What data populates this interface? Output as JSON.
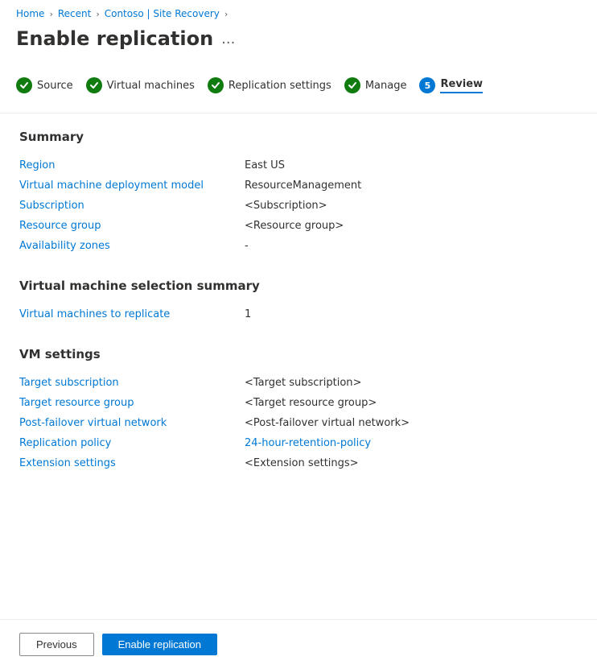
{
  "breadcrumb": {
    "items": [
      {
        "label": "Home",
        "link": true
      },
      {
        "label": "Recent",
        "link": true
      },
      {
        "label": "Contoso | Site Recovery",
        "link": true
      }
    ]
  },
  "page": {
    "title": "Enable replication",
    "dots": "..."
  },
  "steps": [
    {
      "id": "source",
      "label": "Source",
      "state": "complete"
    },
    {
      "id": "virtual-machines",
      "label": "Virtual machines",
      "state": "complete"
    },
    {
      "id": "replication-settings",
      "label": "Replication settings",
      "state": "complete"
    },
    {
      "id": "manage",
      "label": "Manage",
      "state": "complete"
    },
    {
      "id": "review",
      "label": "Review",
      "state": "active",
      "number": "5"
    }
  ],
  "summary": {
    "title": "Summary",
    "rows": [
      {
        "label": "Region",
        "value": "East US",
        "isLink": false
      },
      {
        "label": "Virtual machine deployment model",
        "value": "ResourceManagement",
        "isLink": false
      },
      {
        "label": "Subscription",
        "value": "<Subscription>",
        "isLink": false
      },
      {
        "label": "Resource group",
        "value": "<Resource group>",
        "isLink": false
      },
      {
        "label": "Availability zones",
        "value": "-",
        "isLink": false
      }
    ]
  },
  "vm_selection": {
    "title": "Virtual machine selection summary",
    "rows": [
      {
        "label": "Virtual machines to replicate",
        "value": "1",
        "isLink": false
      }
    ]
  },
  "vm_settings": {
    "title": "VM settings",
    "rows": [
      {
        "label": "Target subscription",
        "value": "<Target subscription>",
        "isLink": false
      },
      {
        "label": "Target resource group",
        "value": "<Target resource group>",
        "isLink": false
      },
      {
        "label": "Post-failover virtual network",
        "value": "<Post-failover virtual network>",
        "isLink": false
      },
      {
        "label": "Replication policy",
        "value": "24-hour-retention-policy",
        "isLink": true
      },
      {
        "label": "Extension settings",
        "value": "<Extension settings>",
        "isLink": false
      }
    ]
  },
  "footer": {
    "prev_label": "Previous",
    "enable_label": "Enable replication"
  }
}
